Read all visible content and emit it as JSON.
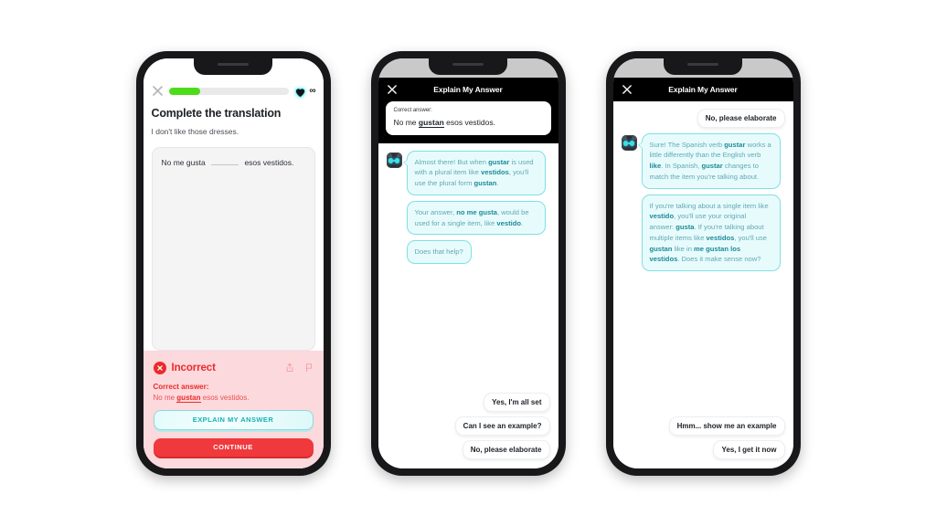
{
  "phone1": {
    "status_bar_style": "white",
    "topbar": {
      "close_icon": "close-icon",
      "progress_percent": 26,
      "hearts_icon": "heart-icon",
      "hearts_value": "∞"
    },
    "title": "Complete the translation",
    "prompt": "I don't like those dresses.",
    "answer_prefix": "No me gusta",
    "answer_suffix": "esos vestidos.",
    "feedback": {
      "status": "Incorrect",
      "status_icon": "x-circle-icon",
      "share_icon": "share-icon",
      "flag_icon": "flag-icon",
      "correct_label": "Correct answer:",
      "correct_answer_pre": "No me ",
      "correct_answer_bold": "gustan",
      "correct_answer_post": " esos vestidos.",
      "explain_button": "EXPLAIN MY ANSWER",
      "continue_button": "CONTINUE"
    }
  },
  "phone2": {
    "header": {
      "close_icon": "close-icon",
      "title": "Explain My Answer"
    },
    "correct_card": {
      "label": "Correct answer:",
      "answer_pre": "No me ",
      "answer_bold": "gustan",
      "answer_post": " esos vestidos."
    },
    "avatar_icon": "lily-avatar-icon",
    "bubbles": [
      {
        "id": "bubble-1",
        "parts": [
          {
            "t": "Almost there! But when ",
            "b": false
          },
          {
            "t": "gustar",
            "b": true
          },
          {
            "t": " is used with a plural item like ",
            "b": false
          },
          {
            "t": "vestidos",
            "b": true
          },
          {
            "t": ", you'll use the plural form ",
            "b": false
          },
          {
            "t": "gustan",
            "b": true
          },
          {
            "t": ".",
            "b": false
          }
        ]
      },
      {
        "id": "bubble-2",
        "parts": [
          {
            "t": "Your answer, ",
            "b": false
          },
          {
            "t": "no me gusta",
            "b": true
          },
          {
            "t": ", would be used for a single item, like ",
            "b": false
          },
          {
            "t": "vestido",
            "b": true
          },
          {
            "t": ".",
            "b": false
          }
        ]
      },
      {
        "id": "bubble-3",
        "parts": [
          {
            "t": "Does that help?",
            "b": false
          }
        ]
      }
    ],
    "replies": [
      "Yes, I'm all set",
      "Can I see an example?",
      "No, please elaborate"
    ]
  },
  "phone3": {
    "header": {
      "close_icon": "close-icon",
      "title": "Explain My Answer"
    },
    "user_message": "No, please elaborate",
    "avatar_icon": "lily-avatar-icon",
    "bubbles": [
      {
        "id": "bubble-1",
        "parts": [
          {
            "t": "Sure! The Spanish verb ",
            "b": false
          },
          {
            "t": "gustar",
            "b": true
          },
          {
            "t": " works a little differently than the English verb ",
            "b": false
          },
          {
            "t": "like",
            "b": true
          },
          {
            "t": ". In Spanish, ",
            "b": false
          },
          {
            "t": "gustar",
            "b": true
          },
          {
            "t": " changes to match the item you're talking about.",
            "b": false
          }
        ]
      },
      {
        "id": "bubble-2",
        "parts": [
          {
            "t": "If you're talking about a single item like ",
            "b": false
          },
          {
            "t": "vestido",
            "b": true
          },
          {
            "t": ", you'll use your original answer: ",
            "b": false
          },
          {
            "t": "gusta",
            "b": true
          },
          {
            "t": ". If you're talking about multiple items like ",
            "b": false
          },
          {
            "t": "vestidos",
            "b": true
          },
          {
            "t": ", you'll use ",
            "b": false
          },
          {
            "t": "gustan",
            "b": true
          },
          {
            "t": " like in ",
            "b": false
          },
          {
            "t": "me gustan los vestidos",
            "b": true
          },
          {
            "t": ". Does it make sense now?",
            "b": false
          }
        ]
      }
    ],
    "replies": [
      "Hmm... show me an example",
      "Yes, I get it now"
    ]
  },
  "colors": {
    "accent_green": "#4ddc19",
    "error_red": "#ea2b2b",
    "error_bg": "#fcd9dc",
    "continue_red": "#f0393d",
    "bubble_teal": "#e8fbfc",
    "bubble_border": "#7fe0e3",
    "bubble_text": "#5fa9b3",
    "bubble_bold": "#1b8b97",
    "explain_teal": "#18b1b8",
    "frame_black": "#18181a"
  }
}
